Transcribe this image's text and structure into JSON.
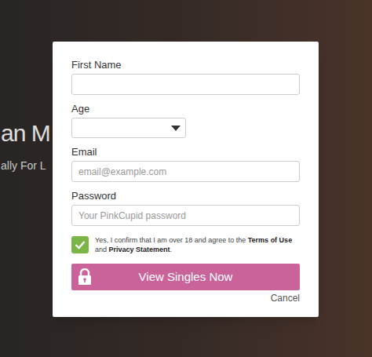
{
  "background": {
    "title": "an M",
    "subtitle": "ally For L"
  },
  "form": {
    "fields": [
      {
        "label": "First Name",
        "kind": "text",
        "placeholder": ""
      },
      {
        "label": "Age",
        "kind": "select",
        "placeholder": ""
      },
      {
        "label": "Email",
        "kind": "text",
        "placeholder": "email@example.com"
      },
      {
        "label": "Password",
        "kind": "password",
        "placeholder": "Your PinkCupid password"
      }
    ],
    "consent": {
      "checked": true,
      "parts": [
        {
          "text": "Yes, I confirm that I am over 18 and agree to the ",
          "bold": false
        },
        {
          "text": "Terms of Use",
          "bold": true
        },
        {
          "text": " and ",
          "bold": false
        },
        {
          "text": "Privacy Statement",
          "bold": true
        },
        {
          "text": ".",
          "bold": false
        }
      ]
    },
    "submit": "View Singles Now",
    "cancel": "Cancel"
  }
}
